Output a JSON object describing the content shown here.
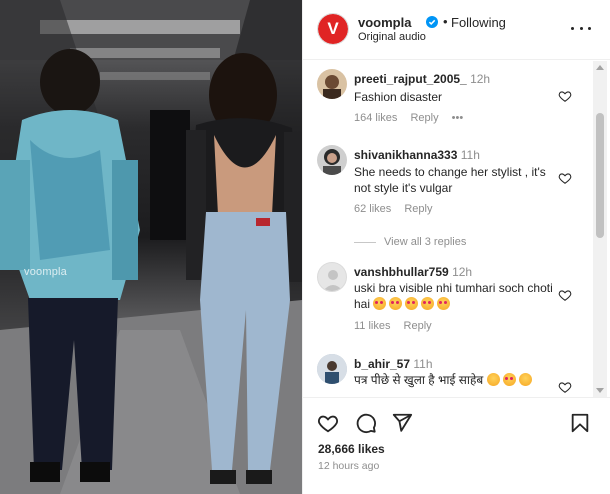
{
  "media": {
    "watermark": "voompla"
  },
  "header": {
    "username": "voompla",
    "separator": "•",
    "follow_label": "Following",
    "subtitle": "Original audio",
    "avatar_letter": "V",
    "avatar_color": "#e02424",
    "verified_icon": "verified-badge-icon",
    "more_icon": "more-horizontal-icon"
  },
  "comments": [
    {
      "username": "preeti_rajput_2005_",
      "time": "12h",
      "text": "Fashion disaster",
      "likes": "164 likes",
      "reply": "Reply",
      "more": "•••"
    },
    {
      "username": "shivanikhanna333",
      "time": "11h",
      "text": "She needs to change her stylist , it's not style it's vulgar",
      "likes": "62 likes",
      "reply": "Reply"
    },
    {
      "username": "vanshbhullar759",
      "time": "12h",
      "text": "uski bra visible nhi tumhari soch choti hai",
      "emoji_count": 5,
      "likes": "11 likes",
      "reply": "Reply"
    },
    {
      "username": "b_ahir_57",
      "time": "11h",
      "text": "पत्र पीछे से खुला है भाई साहेब",
      "emoji_count": 3
    }
  ],
  "view_replies": "View all 3 replies",
  "actions": {
    "like_icon": "heart-icon",
    "comment_icon": "comment-icon",
    "share_icon": "send-icon",
    "save_icon": "bookmark-icon"
  },
  "footer": {
    "likes": "28,666 likes",
    "time_ago": "12 hours ago"
  },
  "colors": {
    "text": "#262626",
    "secondary": "#8e8e8e",
    "brand": "#e02424",
    "verified": "#0095f6"
  }
}
